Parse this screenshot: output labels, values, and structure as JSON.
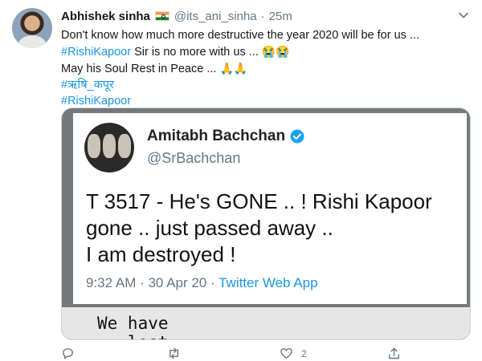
{
  "tweet": {
    "author_name": "Abhishek sinha",
    "flag_icon": "india-flag-icon",
    "handle": "@its_ani_sinha",
    "separator": "·",
    "time": "25m",
    "lines": [
      {
        "text": "Don't know how much more destructive the year 2020 will be for us ..."
      },
      {
        "hashtag": "#RishiKapoor",
        "text": " Sir is no more with us ... ",
        "emoji": "😭😭"
      },
      {
        "text": "May his Soul Rest in Peace ... ",
        "emoji": "🙏🙏"
      },
      {
        "hashtag": "#ऋषि_कपूर"
      },
      {
        "hashtag": "#RishiKapoor"
      }
    ]
  },
  "embedded_image": {
    "author_name": "Amitabh Bachchan",
    "handle": "@SrBachchan",
    "text_lines": [
      "T 3517 - He's GONE .. ! Rishi Kapoor",
      "gone .. just passed away ..",
      "I am destroyed !"
    ],
    "timestamp": "9:32 AM · 30 Apr 20 · ",
    "source": "Twitter Web App",
    "handwritten_lines": [
      "We have",
      "   lost"
    ]
  },
  "actions": {
    "reply_count": "",
    "retweet_count": "",
    "like_count": "2",
    "share_count": ""
  },
  "colors": {
    "link": "#1b95e0",
    "muted": "#657786",
    "text": "#14171a"
  }
}
